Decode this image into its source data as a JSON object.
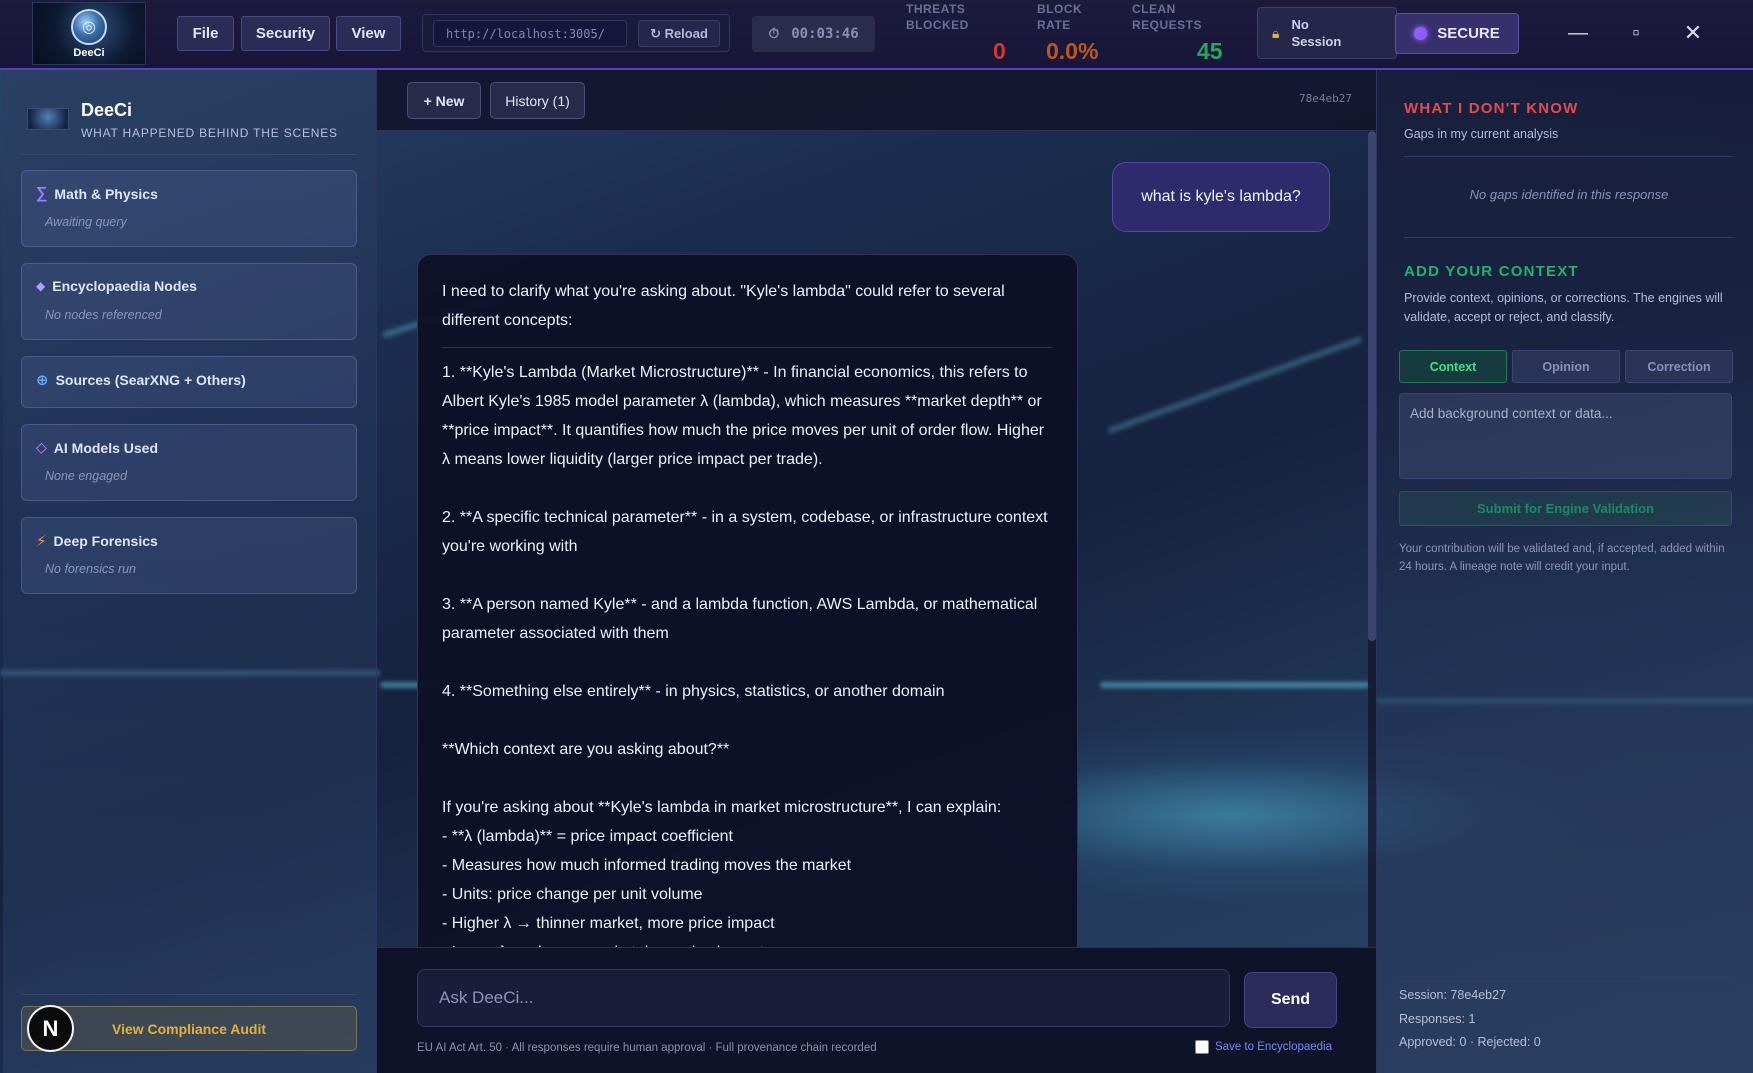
{
  "topbar": {
    "logo_text": "DeeCi",
    "menu": [
      "File",
      "Security",
      "View"
    ],
    "url": "http://localhost:3005/",
    "reload_label": "↻ Reload",
    "timer": "00:03:46",
    "stats": [
      {
        "label_line1": "THREATS",
        "label_line2": "BLOCKED",
        "value": "0",
        "color": "#cc3b2f"
      },
      {
        "label_line1": "BLOCK",
        "label_line2": "RATE",
        "value": "0.0%",
        "color": "#c0561f"
      },
      {
        "label_line1": "CLEAN",
        "label_line2": "REQUESTS",
        "value": "45",
        "color": "#23a957"
      }
    ],
    "session_line1": "No",
    "session_line2": "Session",
    "secure_label": "SECURE",
    "window": {
      "minimize": "—",
      "maximize": "▫",
      "close": "✕"
    }
  },
  "sidebar": {
    "brand_name": "DeeCi",
    "brand_sub": "WHAT HAPPENED BEHIND THE SCENES",
    "cards": [
      {
        "icon": "sigma-icon",
        "glyph": "∑",
        "title": "Math & Physics",
        "status": "Awaiting query"
      },
      {
        "icon": "diamond-icon",
        "glyph": "◆",
        "title": "Encyclopaedia Nodes",
        "status": "No nodes referenced"
      },
      {
        "icon": "globe-icon",
        "glyph": "⊕",
        "title": "Sources (SearXNG + Others)",
        "status": ""
      },
      {
        "icon": "diamond-outline-icon",
        "glyph": "◇",
        "title": "AI Models Used",
        "status": "None engaged"
      },
      {
        "icon": "bolt-icon",
        "glyph": "⚡",
        "title": "Deep Forensics",
        "status": "No forensics run"
      }
    ],
    "avatar_letter": "N",
    "audit_label": "View Compliance Audit"
  },
  "chat": {
    "new_label": "+ New",
    "history_label": "History (1)",
    "hash": "78e4eb27",
    "user_message": "what is kyle's lambda?",
    "reply_intro": "I need to clarify what you're asking about. \"Kyle's lambda\" could refer to several different concepts:",
    "reply_items": [
      "1. **Kyle's Lambda (Market Microstructure)** - In financial economics, this refers to Albert Kyle's 1985 model parameter λ (lambda), which measures **market depth** or **price impact**. It quantifies how much the price moves per unit of order flow. Higher λ means lower liquidity (larger price impact per trade).",
      "2. **A specific technical parameter** - in a system, codebase, or infrastructure context you're working with",
      "3. **A person named Kyle** - and a lambda function, AWS Lambda, or mathematical parameter associated with them",
      "4. **Something else entirely** - in physics, statistics, or another domain",
      "**Which context are you asking about?**"
    ],
    "reply_tail_intro": "If you're asking about **Kyle's lambda in market microstructure**, I can explain:",
    "reply_bullets": [
      "- **λ (lambda)** = price impact coefficient",
      "- Measures how much informed trading moves the market",
      "- Units: price change per unit volume",
      "- Higher λ → thinner market, more price impact",
      "- Lower λ → deeper market, less price impact"
    ],
    "input_placeholder": "Ask DeeCi...",
    "send_label": "Send",
    "compliance_note": "EU AI Act Art. 50 · All responses require human approval · Full provenance chain recorded",
    "save_label": "Save to Encyclopaedia"
  },
  "right_panel": {
    "unknown_title": "WHAT I DON'T KNOW",
    "unknown_sub": "Gaps in my current analysis",
    "unknown_empty": "No gaps identified in this response",
    "context_title": "ADD YOUR CONTEXT",
    "context_desc": "Provide context, opinions, or corrections. The engines will validate, accept or reject, and classify.",
    "tabs": [
      "Context",
      "Opinion",
      "Correction"
    ],
    "active_tab": "Context",
    "textarea_placeholder": "Add background context or data...",
    "submit_label": "Submit for Engine Validation",
    "note": "Your contribution will be validated and, if accepted, added within 24 hours. A lineage note will credit your input.",
    "footer": {
      "session": "Session: 78e4eb27",
      "responses": "Responses: 1",
      "approvals": "Approved: 0 · Rejected: 0"
    }
  },
  "colors": {
    "accent_purple": "#5b3fbf",
    "danger": "#e84a4a",
    "success": "#1fb46a",
    "audit_gold": "#e3b13b"
  }
}
